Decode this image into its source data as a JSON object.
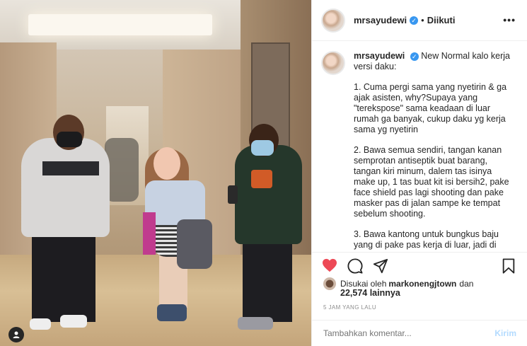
{
  "post": {
    "username": "mrsayudewi",
    "verified_mark": "✓",
    "follow_status": "Diikuti",
    "more": "•••",
    "caption_title": "New Normal kalo kerja versi daku:",
    "caption_paragraphs": [
      "1. Cuma pergi sama yang nyetirin & ga ajak asisten, why?Supaya yang \"terekspose\" sama keadaan di luar rumah ga banyak, cukup daku yg kerja sama yg nyetirin",
      "2. Bawa semua sendiri, tangan kanan semprotan antiseptik buat barang, tangan kiri minum, dalem tas isinya make up, 1 tas buat kit isi bersih2, pake face shield pas lagi shooting dan pake masker pas di jalan sampe ke tempat sebelum shooting.",
      "3. Bawa kantong untuk bungkus baju yang di pake pas kerja di luar, jadi di"
    ],
    "liked_by_prefix": "Disukai oleh",
    "liked_by_user": "markonengjtown",
    "liked_by_and": "dan",
    "likes_count": "22,574 lainnya",
    "time": "5 JAM YANG LALU",
    "comment_placeholder": "Tambahkan komentar...",
    "post_button": "Kirim"
  },
  "icons": [
    "heart-icon",
    "comment-icon",
    "share-icon",
    "bookmark-icon",
    "more-icon",
    "verified-icon",
    "user-tag-icon"
  ],
  "colors": {
    "like_red": "#ed4956",
    "verified_blue": "#3897f0",
    "post_disabled": "#b3dbff",
    "muted": "#8e8e8e"
  }
}
